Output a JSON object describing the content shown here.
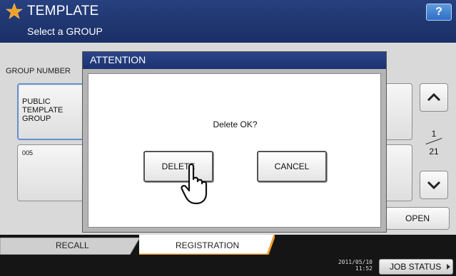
{
  "header": {
    "title": "TEMPLATE",
    "subtitle": "Select a GROUP",
    "help_label": "?",
    "star_icon": "star-icon"
  },
  "main": {
    "group_number_label": "GROUP NUMBER",
    "tiles": [
      {
        "label": "PUBLIC\nTEMPLATE\nGROUP",
        "selected": true
      },
      {
        "label": "005",
        "selected": false
      }
    ],
    "pager": {
      "current": "1",
      "total": "21"
    },
    "open_label": "OPEN"
  },
  "dialog": {
    "title": "ATTENTION",
    "message": "Delete OK?",
    "delete_label": "DELETE",
    "cancel_label": "CANCEL"
  },
  "tabs": [
    {
      "label": "RECALL",
      "active": false
    },
    {
      "label": "REGISTRATION",
      "active": true
    }
  ],
  "status": {
    "date": "2011/05/10",
    "time": "11:52",
    "job_status_label": "JOB STATUS"
  },
  "colors": {
    "header_blue": "#1f356f",
    "star_orange": "#f4a020",
    "active_tab": "#ffffff",
    "tab_accent": "#f0a030"
  }
}
